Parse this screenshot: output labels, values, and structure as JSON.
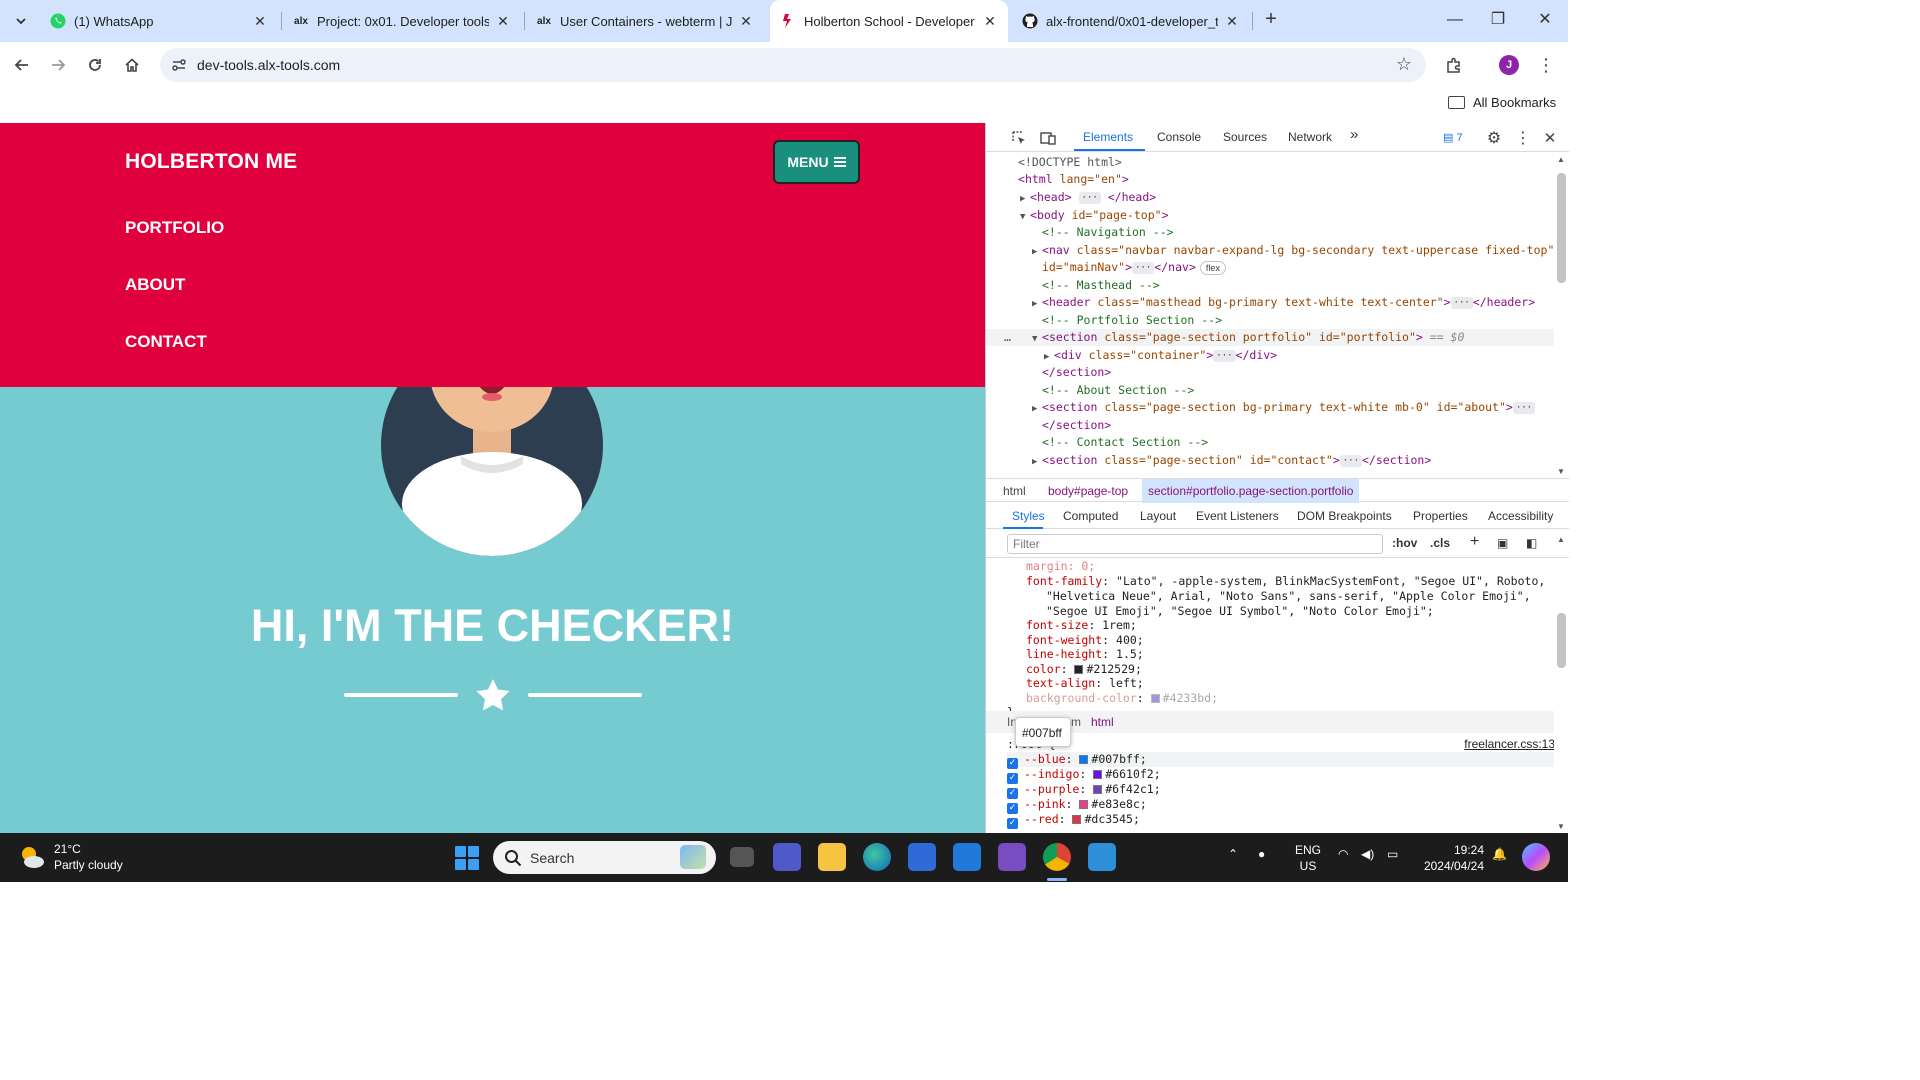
{
  "browser": {
    "tabs": [
      {
        "title": "(1) WhatsApp",
        "icon": "whatsapp-icon",
        "active": false
      },
      {
        "title": "Project: 0x01. Developer tools | ",
        "icon": "alx-icon",
        "active": false
      },
      {
        "title": "User Containers - webterm | Jo",
        "icon": "alx-icon",
        "active": false
      },
      {
        "title": "Holberton School - Developer",
        "icon": "holberton-icon",
        "active": true
      },
      {
        "title": "alx-frontend/0x01-developer_t",
        "icon": "github-icon",
        "active": false
      }
    ],
    "url": "dev-tools.alx-tools.com",
    "avatar_letter": "J",
    "all_bookmarks": "All Bookmarks"
  },
  "page": {
    "brand": "HOLBERTON ME",
    "menu_label": "MENU",
    "nav_links": [
      "PORTFOLIO",
      "ABOUT",
      "CONTACT"
    ],
    "hero_title": "HI, I'M THE CHECKER!",
    "colors": {
      "nav_bg": "#e0003d",
      "masthead_bg": "#76cbd1",
      "menu_btn": "#1a8f7e"
    }
  },
  "devtools": {
    "tabs": [
      "Elements",
      "Console",
      "Sources",
      "Network"
    ],
    "more": "»",
    "issues_count": "7",
    "dom": [
      {
        "text": "<!DOCTYPE html>"
      },
      {
        "tag": "html",
        "attrs": " lang=\"en\""
      },
      {
        "tag": "head",
        "collapsed": true
      },
      {
        "tag": "body",
        "attrs": " id=\"page-top\""
      },
      {
        "comment": "<!-- Navigation -->"
      },
      {
        "tag": "nav",
        "attrs": " class=\"navbar navbar-expand-lg bg-secondary text-uppercase fixed-top\"",
        "attrs2": "id=\"mainNav\"",
        "badge": "flex"
      },
      {
        "comment": "<!-- Masthead -->"
      },
      {
        "tag": "header",
        "attrs": " class=\"masthead bg-primary text-white text-center\""
      },
      {
        "comment": "<!-- Portfolio Section -->"
      },
      {
        "tag": "section",
        "attrs": " class=\"page-section portfolio\" id=\"portfolio\"",
        "selected_marker": "== $0"
      },
      {
        "tag": "div",
        "attrs": " class=\"container\""
      },
      {
        "close": "</section>"
      },
      {
        "comment": "<!-- About Section -->"
      },
      {
        "tag": "section",
        "attrs": " class=\"page-section bg-primary text-white mb-0\" id=\"about\""
      },
      {
        "close": "</section>"
      },
      {
        "comment": "<!-- Contact Section -->"
      },
      {
        "tag": "section",
        "attrs": " class=\"page-section\" id=\"contact\""
      }
    ],
    "breadcrumbs": [
      "html",
      "body#page-top",
      "section#portfolio.page-section.portfolio"
    ],
    "styles_tabs": [
      "Styles",
      "Computed",
      "Layout",
      "Event Listeners",
      "DOM Breakpoints",
      "Properties",
      "Accessibility"
    ],
    "filter_placeholder": "Filter",
    "hov": ":hov",
    "cls": ".cls",
    "body_rule": [
      {
        "name": "font-family",
        "value": "\"Lato\", -apple-system, BlinkMacSystemFont, \"Segoe UI\", Roboto,"
      },
      {
        "name": "",
        "value": "\"Helvetica Neue\", Arial, \"Noto Sans\", sans-serif, \"Apple Color Emoji\","
      },
      {
        "name": "",
        "value": "\"Segoe UI Emoji\", \"Segoe UI Symbol\", \"Noto Color Emoji\";"
      },
      {
        "name": "font-size",
        "value": "1rem;"
      },
      {
        "name": "font-weight",
        "value": "400;"
      },
      {
        "name": "line-height",
        "value": "1.5;"
      },
      {
        "name": "color",
        "value": "#212529;",
        "swatch": "#212529"
      },
      {
        "name": "text-align",
        "value": "left;"
      },
      {
        "name": "background-color",
        "value": "#4233bd;",
        "swatch": "#4233bd",
        "dim": true
      }
    ],
    "inherited_label": "Inherited from",
    "inherited_from": "html",
    "root_selector": ":root {",
    "source_link": "freelancer.css:13",
    "tooltip": "#007bff",
    "root_vars": [
      {
        "name": "--blue",
        "value": "#007bff;",
        "swatch": "#007bff"
      },
      {
        "name": "--indigo",
        "value": "#6610f2;",
        "swatch": "#6610f2"
      },
      {
        "name": "--purple",
        "value": "#6f42c1;",
        "swatch": "#6f42c1"
      },
      {
        "name": "--pink",
        "value": "#e83e8c;",
        "swatch": "#e83e8c"
      },
      {
        "name": "--red",
        "value": "#dc3545;",
        "swatch": "#dc3545"
      }
    ]
  },
  "taskbar": {
    "temperature": "21°C",
    "weather": "Partly cloudy",
    "search": "Search",
    "lang": "ENG",
    "region": "US",
    "time": "19:24",
    "date": "2024/04/24"
  }
}
